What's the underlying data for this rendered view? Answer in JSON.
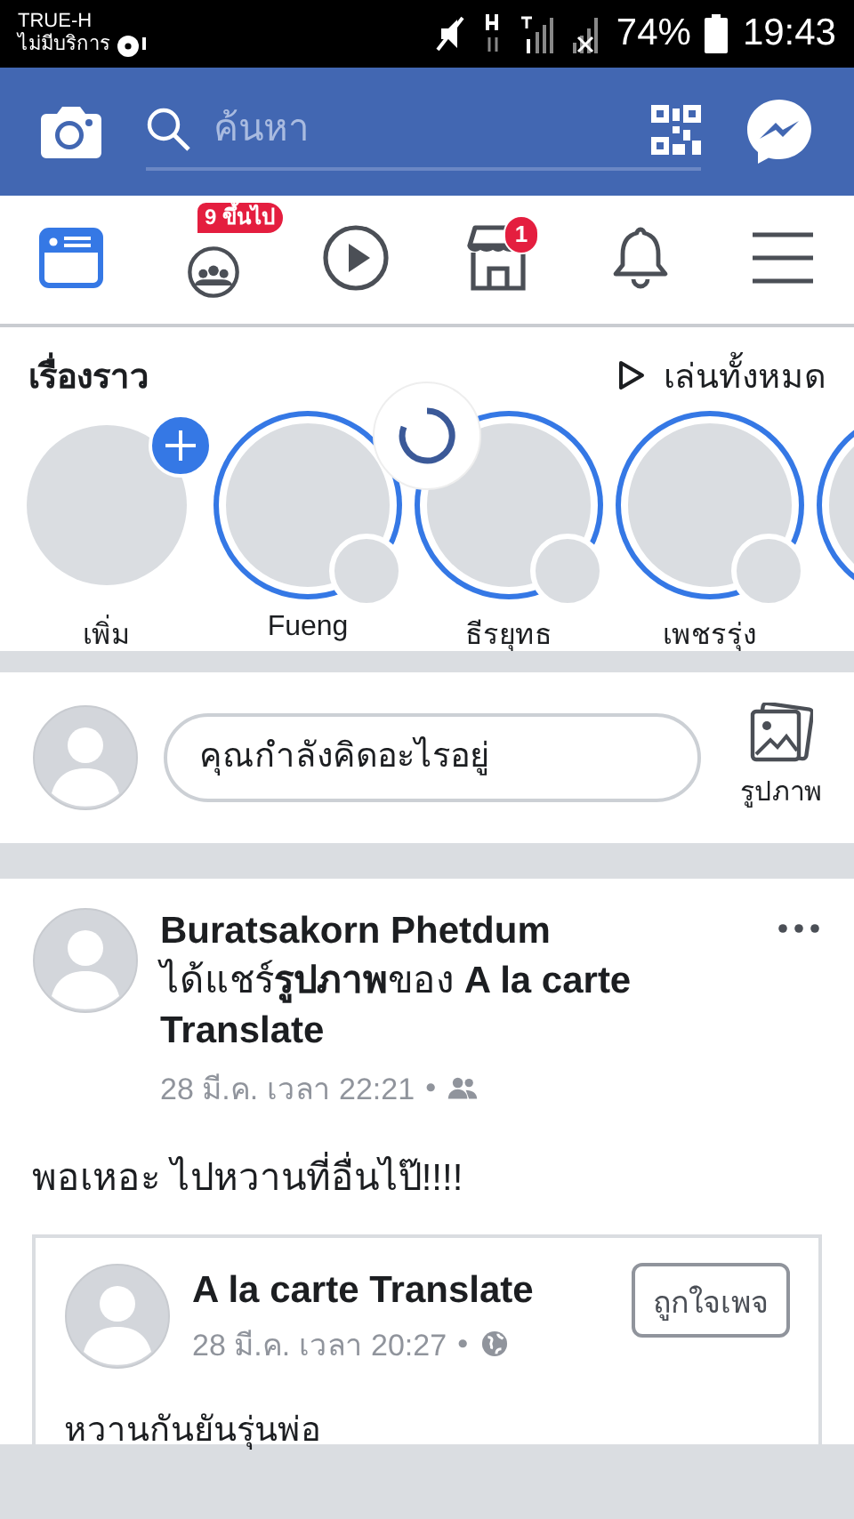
{
  "status_bar": {
    "carrier": "TRUE-H",
    "service": "ไม่มีบริการ",
    "battery": "74%",
    "time": "19:43"
  },
  "header": {
    "search": {
      "placeholder": "ค้นหา"
    }
  },
  "tabs": [
    {
      "kind": "feed",
      "selected": true
    },
    {
      "kind": "groups",
      "badge": "9 ขึ้นไป",
      "selected": false
    },
    {
      "kind": "watch",
      "selected": false
    },
    {
      "kind": "marketplace",
      "badge": "1",
      "selected": false
    },
    {
      "kind": "notifications",
      "selected": false
    },
    {
      "kind": "menu",
      "selected": false
    }
  ],
  "stories": {
    "title": "เรื่องราว",
    "play_all": "เล่นทั้งหมด",
    "items": [
      {
        "kind": "add",
        "label": "เพิ่ม"
      },
      {
        "kind": "story",
        "label": "Fueng"
      },
      {
        "kind": "story",
        "label": "ธีรยุทธ"
      },
      {
        "kind": "story",
        "label": "เพชรรุ่ง"
      },
      {
        "kind": "story"
      }
    ]
  },
  "composer": {
    "placeholder": "คุณกำลังคิดอะไรอยู่",
    "photo_label": "รูปภาพ"
  },
  "post": {
    "author": "Buratsakorn Phetdum",
    "action": "ได้แชร์**รูปภาพ**ของ **A la carte Translate**",
    "time": "28 มี.ค. เวลา 22:21",
    "separator": "•",
    "text": "พอเหอะ ไปหวานที่อื่นไป๊!!!!",
    "shared": {
      "author": "A la carte Translate",
      "time": "28 มี.ค. เวลา 20:27",
      "separator": "•",
      "like_button": "ถูกใจเพจ",
      "text": "หวานกันยันรุ่นพ่อ"
    }
  }
}
